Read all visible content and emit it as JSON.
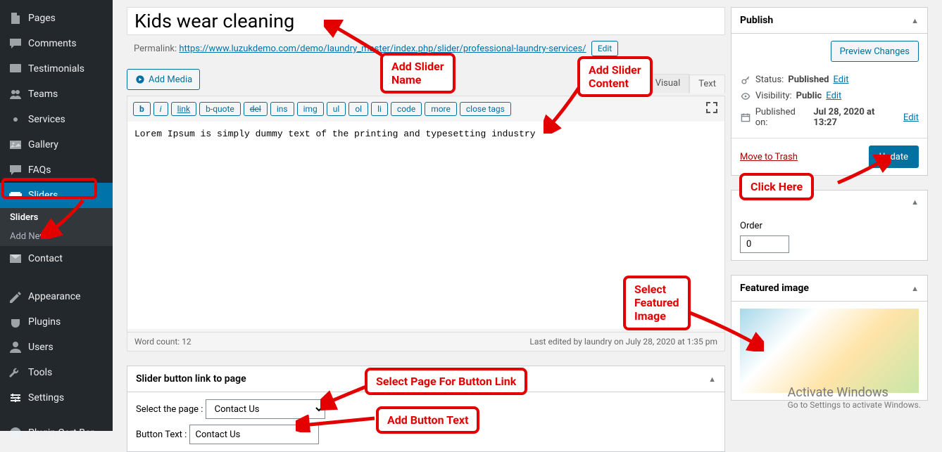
{
  "sidebar": {
    "items": [
      {
        "label": "Pages",
        "icon": "page"
      },
      {
        "label": "Comments",
        "icon": "comment"
      },
      {
        "label": "Testimonials",
        "icon": "testimonial"
      },
      {
        "label": "Teams",
        "icon": "team"
      },
      {
        "label": "Services",
        "icon": "service"
      },
      {
        "label": "Gallery",
        "icon": "gallery"
      },
      {
        "label": "FAQs",
        "icon": "faq"
      },
      {
        "label": "Sliders",
        "icon": "slider"
      },
      {
        "label": "Contact",
        "icon": "contact"
      },
      {
        "label": "Appearance",
        "icon": "appearance"
      },
      {
        "label": "Plugins",
        "icon": "plugin"
      },
      {
        "label": "Users",
        "icon": "user"
      },
      {
        "label": "Tools",
        "icon": "tool"
      },
      {
        "label": "Settings",
        "icon": "settings"
      },
      {
        "label": "Plugin Cart Bar",
        "icon": "cart"
      }
    ],
    "sub": {
      "sliders": "Sliders",
      "addnew": "Add New"
    }
  },
  "editor": {
    "title": "Kids wear cleaning",
    "permalink_label": "Permalink:",
    "permalink_url": "https://www.luzukdemo.com/demo/laundry_master/index.php/slider/professional-laundry-services/",
    "edit_btn": "Edit",
    "add_media": "Add Media",
    "visual_tab": "Visual",
    "text_tab": "Text",
    "quicktags": [
      "b",
      "i",
      "link",
      "b-quote",
      "del",
      "ins",
      "img",
      "ul",
      "ol",
      "li",
      "code",
      "more",
      "close tags"
    ],
    "content": "Lorem Ipsum is simply dummy text of the printing and typesetting industry",
    "word_count": "Word count: 12",
    "last_edited": "Last edited by laundry on July 28, 2020 at 1:35 pm"
  },
  "slider_box": {
    "title": "Slider button link to page",
    "select_label": "Select the page :",
    "select_value": "Contact Us",
    "button_label": "Button Text :",
    "button_value": "Contact Us"
  },
  "publish": {
    "title": "Publish",
    "preview": "Preview Changes",
    "status_label": "Status:",
    "status_value": "Published",
    "visibility_label": "Visibility:",
    "visibility_value": "Public",
    "published_label": "Published on:",
    "published_value": "Jul 28, 2020 at 13:27",
    "edit_link": "Edit",
    "trash": "Move to Trash",
    "update": "Update"
  },
  "attributes": {
    "order_label": "Order",
    "order_value": "0"
  },
  "featured": {
    "title": "Featured image"
  },
  "annotations": {
    "slider_name": "Add Slider\nName",
    "slider_content": "Add Slider\nContent",
    "click_here": "Click Here",
    "featured_img": "Select\nFeatured\nImage",
    "page_link": "Select Page For Button Link",
    "button_text": "Add Button Text"
  },
  "watermark": {
    "title": "Activate Windows",
    "sub": "Go to Settings to activate Windows."
  }
}
